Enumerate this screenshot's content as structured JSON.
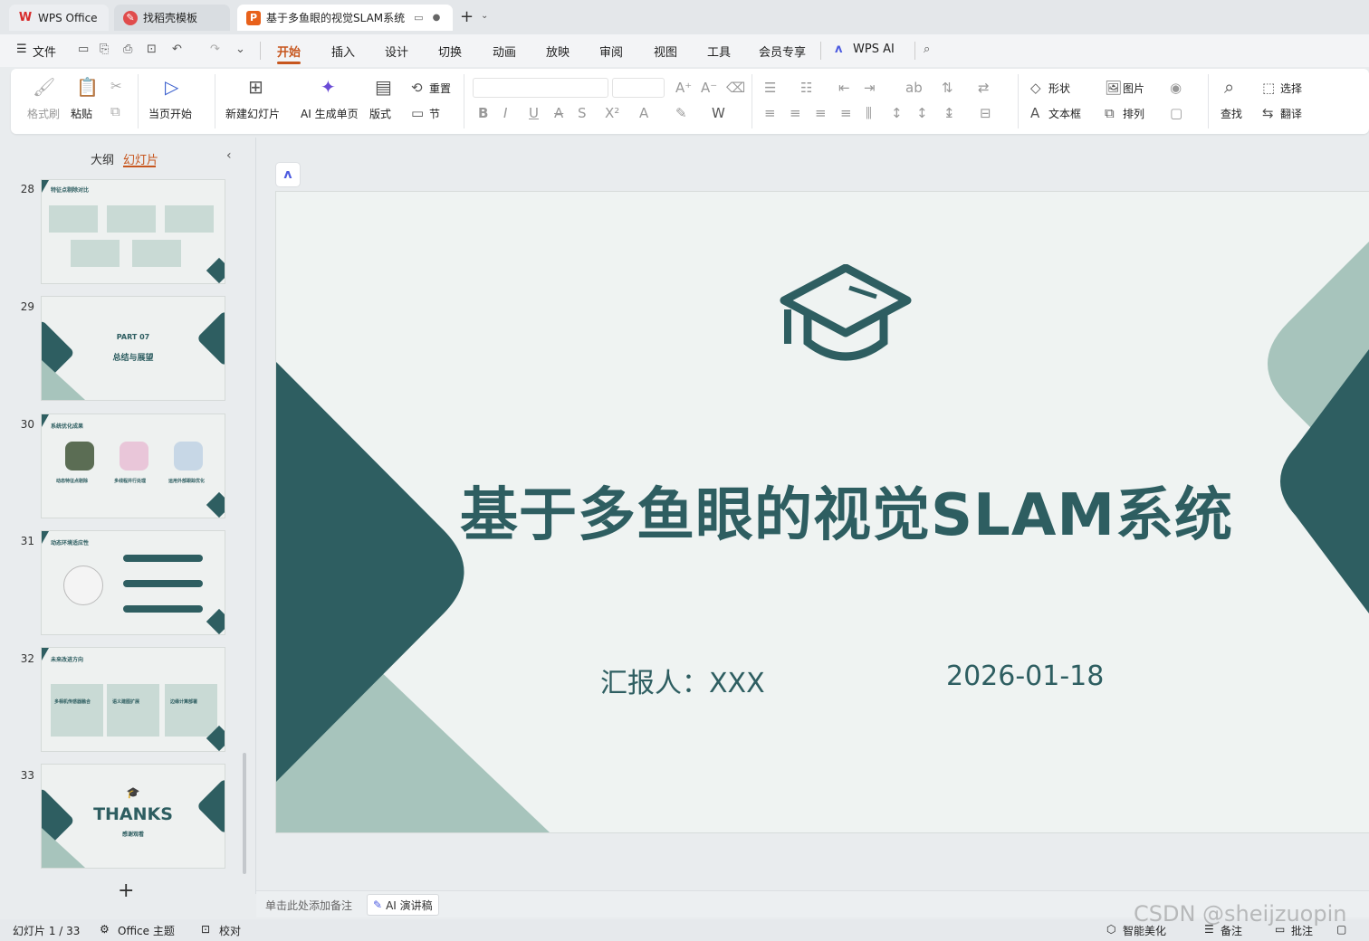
{
  "tabs": [
    {
      "label": "WPS Office",
      "icon": "wps-logo-icon"
    },
    {
      "label": "找稻壳模板",
      "icon": "docer-icon"
    },
    {
      "label": "基于多鱼眼的视觉SLAM系统",
      "icon": "presentation-icon"
    }
  ],
  "menu": {
    "file": "文件",
    "items": [
      "开始",
      "插入",
      "设计",
      "切换",
      "动画",
      "放映",
      "审阅",
      "视图",
      "工具",
      "会员专享"
    ],
    "ai": "WPS AI"
  },
  "ribbon": {
    "format_painter": "格式刷",
    "paste": "粘贴",
    "from_current": "当页开始",
    "new_slide": "新建幻灯片",
    "ai_page": "AI 生成单页",
    "layout": "版式",
    "reset": "重置",
    "section": "节",
    "shape": "形状",
    "picture": "图片",
    "textbox": "文本框",
    "arrange": "排列",
    "find": "查找",
    "select": "选择",
    "translate": "翻译"
  },
  "panel": {
    "outline": "大纲",
    "slides": "幻灯片"
  },
  "thumbnails": [
    {
      "num": "28",
      "title": "特征点剔除对比"
    },
    {
      "num": "29",
      "part": "PART 07",
      "title": "总结与展望"
    },
    {
      "num": "30",
      "title": "系统优化成果",
      "captions": [
        "动态特征点剔除",
        "多线程并行处理",
        "运用外部跟踪优化"
      ]
    },
    {
      "num": "31",
      "title": "动态环境适应性"
    },
    {
      "num": "32",
      "title": "未来改进方向",
      "captions": [
        "多相机传感器融合",
        "语义建图扩展",
        "边缘计算部署"
      ]
    },
    {
      "num": "33",
      "title": "THANKS",
      "sub": "感谢观看"
    }
  ],
  "slide": {
    "title": "基于多鱼眼的视觉SLAM系统",
    "reporter": "汇报人：XXX",
    "date": "2026-01-18"
  },
  "notes": {
    "placeholder": "单击此处添加备注",
    "ai_button": "AI 演讲稿"
  },
  "status": {
    "slide_counter": "幻灯片 1 / 33",
    "theme": "Office 主题",
    "proof": "校对",
    "beautify": "智能美化",
    "notes": "备注",
    "comments": "批注",
    "watermark": "CSDN @sheijzuopin"
  },
  "colors": {
    "accent": "#2e5e61",
    "light": "#a7c4bc",
    "tab_active": "#c7561e"
  }
}
